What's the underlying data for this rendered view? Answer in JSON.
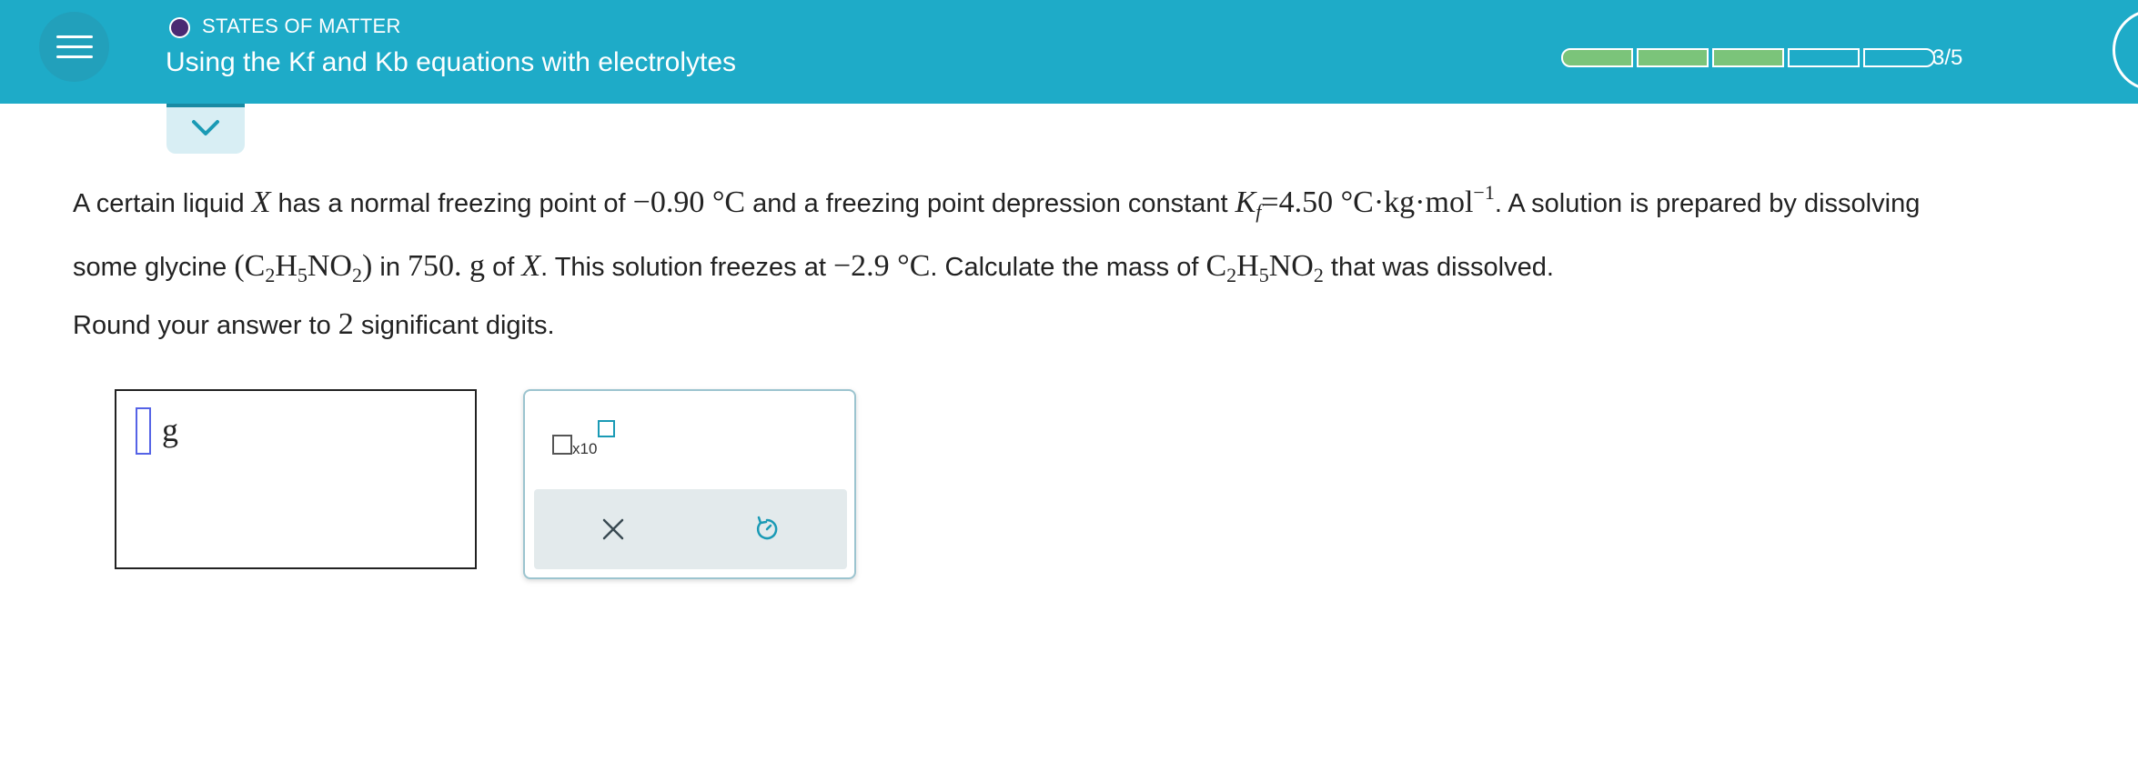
{
  "header": {
    "topic": "STATES OF MATTER",
    "title": "Using the Kf and Kb equations with electrolytes",
    "progress": {
      "completed": 3,
      "total": 5,
      "label": "3/5"
    },
    "colors": {
      "bar": "#1eabc8",
      "progress_done": "#7bc47a",
      "topic_dot": "#4a2a73"
    }
  },
  "question": {
    "t1": "A certain liquid",
    "X": "X",
    "t2": "has a normal freezing point of",
    "fp_value": "−0.90 °C",
    "t3": "and a freezing point depression constant",
    "K": "K",
    "kf_sub": "f",
    "kf_value": "=4.50 °C·kg·mol",
    "kf_exp": "−1",
    "t4": ". A solution is prepared by dissolving",
    "t5": "some glycine",
    "formula_open": "(C",
    "sub2": "2",
    "H": "H",
    "sub5": "5",
    "NO": "NO",
    "formula_close": ")",
    "t6": "in",
    "mass_solvent": "750. g",
    "t7": "of",
    "t8": ". This solution freezes at",
    "solution_fp": "−2.9 °C",
    "t9": ". Calculate the mass of",
    "C": "C",
    "t10": "that was dissolved."
  },
  "instruction": {
    "before": "Round your answer to",
    "digits": "2",
    "after": "significant digits."
  },
  "answer": {
    "value": "",
    "unit": "g"
  },
  "palette": {
    "sci_label": "x10",
    "clear_icon": "x-icon",
    "undo_icon": "undo-icon"
  }
}
